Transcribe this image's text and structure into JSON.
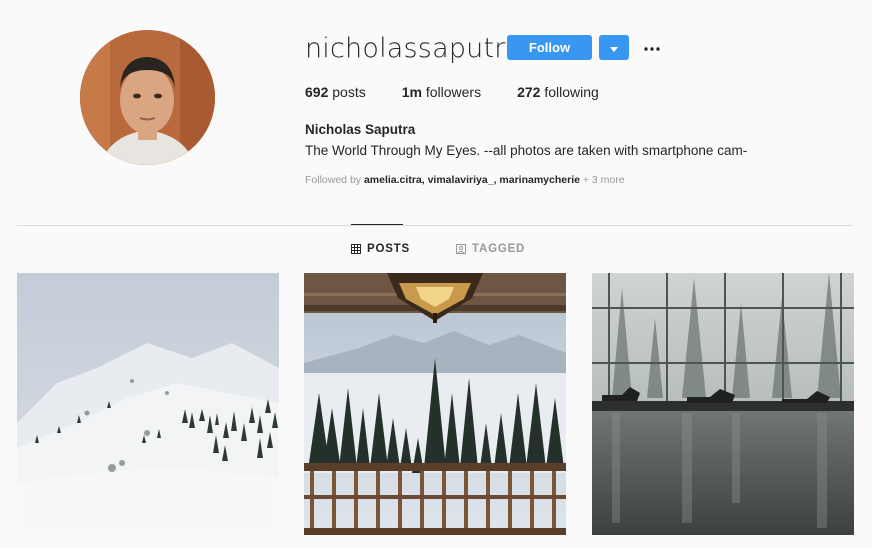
{
  "profile": {
    "username": "nicholassaputra",
    "full_name": "Nicholas Saputra",
    "bio": "The World Through My Eyes. --all photos are taken with smartphone cam-",
    "verified": true
  },
  "actions": {
    "follow_label": "Follow"
  },
  "stats": {
    "posts_count": "692",
    "posts_label": "posts",
    "followers_count": "1m",
    "followers_label": "followers",
    "following_count": "272",
    "following_label": "following"
  },
  "followed_by": {
    "prefix": "Followed by",
    "names": [
      "amelia.citra",
      "vimalaviriya_",
      "marinamycherie"
    ],
    "more": "+ 3 more"
  },
  "tabs": [
    {
      "label": "POSTS",
      "icon": "grid-icon",
      "active": true
    },
    {
      "label": "TAGGED",
      "icon": "tag-icon",
      "active": false
    }
  ],
  "colors": {
    "accent": "#3897f0",
    "text": "#262626",
    "muted": "#999999",
    "background": "#fafafa"
  },
  "posts": [
    {
      "description": "snowy mountain slope with pine trees"
    },
    {
      "description": "lamp above balcony overlooking snowy pine forest"
    },
    {
      "description": "indoor pool with glass wall and misty forest"
    }
  ]
}
